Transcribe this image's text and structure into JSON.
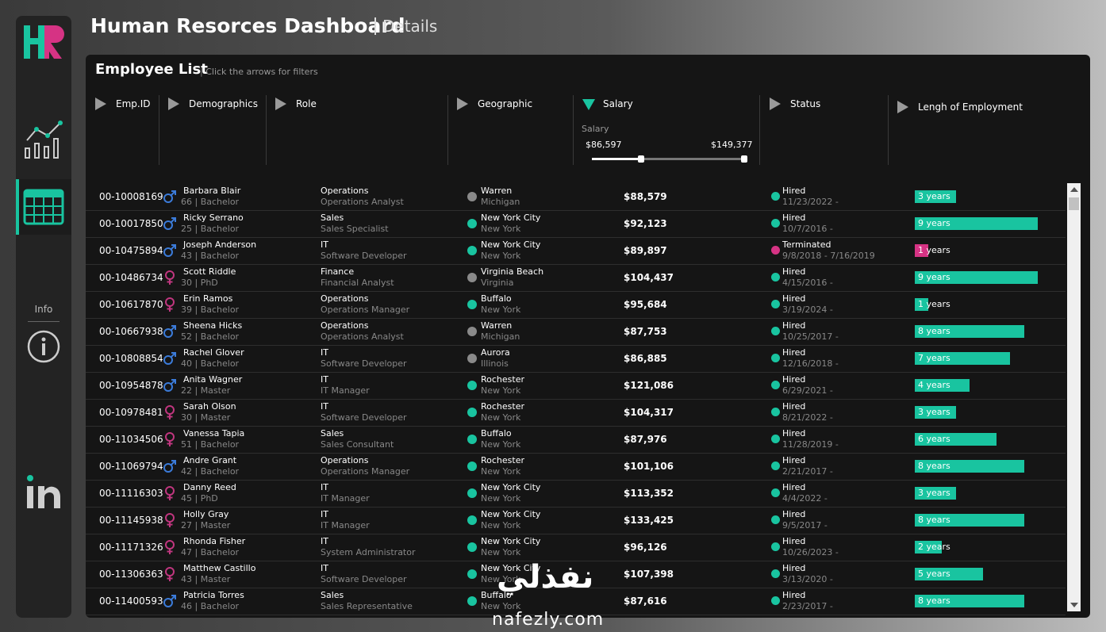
{
  "header": {
    "title": "Human Resorces Dashboard",
    "subtitle": "Details"
  },
  "sidebar": {
    "logo_text": "HR",
    "info_label": "Info",
    "linkedin_text": "in"
  },
  "panel": {
    "title": "Employee List",
    "hint": "Click the arrows for filters"
  },
  "filters": {
    "emp_id": "Emp.ID",
    "demographics": "Demographics",
    "role": "Role",
    "geographic": "Geographic",
    "salary": "Salary",
    "status": "Status",
    "length": "Lengh of Employment",
    "salary_slider": {
      "label": "Salary",
      "min": "$86,597",
      "max": "$149,377"
    }
  },
  "colors": {
    "accent": "#19c4a0",
    "terminated": "#d63384",
    "male": "#3b7bd9",
    "female": "#c0367f",
    "grey_dot": "#8a8a8a"
  },
  "employees": [
    {
      "id": "00-10008169",
      "gender": "male",
      "name": "Barbara Blair",
      "demo": "66  |  Bachelor",
      "dept": "Operations",
      "role": "Operations Analyst",
      "city": "Warren",
      "state": "Michigan",
      "geo": "grey",
      "salary": "$88,579",
      "status": "Hired",
      "date": "11/23/2022 -",
      "years": 3,
      "years_label": "3 years"
    },
    {
      "id": "00-10017850",
      "gender": "male",
      "name": "Ricky Serrano",
      "demo": "25  |  Bachelor",
      "dept": "Sales",
      "role": "Sales Specialist",
      "city": "New York City",
      "state": "New York",
      "geo": "teal",
      "salary": "$92,123",
      "status": "Hired",
      "date": "10/7/2016 -",
      "years": 9,
      "years_label": "9 years"
    },
    {
      "id": "00-10475894",
      "gender": "male",
      "name": "Joseph Anderson",
      "demo": "43  |  Bachelor",
      "dept": "IT",
      "role": "Software Developer",
      "city": "New York City",
      "state": "New York",
      "geo": "teal",
      "salary": "$89,897",
      "status": "Terminated",
      "date": "9/8/2018 - 7/16/2019",
      "years": 1,
      "years_label": "1 years"
    },
    {
      "id": "00-10486734",
      "gender": "female",
      "name": "Scott Riddle",
      "demo": "30  |  PhD",
      "dept": "Finance",
      "role": "Financial Analyst",
      "city": "Virginia Beach",
      "state": "Virginia",
      "geo": "grey",
      "salary": "$104,437",
      "status": "Hired",
      "date": "4/15/2016 -",
      "years": 9,
      "years_label": "9 years"
    },
    {
      "id": "00-10617870",
      "gender": "female",
      "name": "Erin Ramos",
      "demo": "39  |  Bachelor",
      "dept": "Operations",
      "role": "Operations Manager",
      "city": "Buffalo",
      "state": "New York",
      "geo": "teal",
      "salary": "$95,684",
      "status": "Hired",
      "date": "3/19/2024 -",
      "years": 1,
      "years_label": "1 years"
    },
    {
      "id": "00-10667938",
      "gender": "male",
      "name": "Sheena Hicks",
      "demo": "52  |  Bachelor",
      "dept": "Operations",
      "role": "Operations Analyst",
      "city": "Warren",
      "state": "Michigan",
      "geo": "grey",
      "salary": "$87,753",
      "status": "Hired",
      "date": "10/25/2017 -",
      "years": 8,
      "years_label": "8 years"
    },
    {
      "id": "00-10808854",
      "gender": "male",
      "name": "Rachel Glover",
      "demo": "40  |  Bachelor",
      "dept": "IT",
      "role": "Software Developer",
      "city": "Aurora",
      "state": "Illinois",
      "geo": "grey",
      "salary": "$86,885",
      "status": "Hired",
      "date": "12/16/2018 -",
      "years": 7,
      "years_label": "7 years"
    },
    {
      "id": "00-10954878",
      "gender": "male",
      "name": "Anita Wagner",
      "demo": "22  |  Master",
      "dept": "IT",
      "role": "IT Manager",
      "city": "Rochester",
      "state": "New York",
      "geo": "teal",
      "salary": "$121,086",
      "status": "Hired",
      "date": "6/29/2021 -",
      "years": 4,
      "years_label": "4 years"
    },
    {
      "id": "00-10978481",
      "gender": "female",
      "name": "Sarah Olson",
      "demo": "30  |  Master",
      "dept": "IT",
      "role": "Software Developer",
      "city": "Rochester",
      "state": "New York",
      "geo": "teal",
      "salary": "$104,317",
      "status": "Hired",
      "date": "8/21/2022 -",
      "years": 3,
      "years_label": "3 years"
    },
    {
      "id": "00-11034506",
      "gender": "female",
      "name": "Vanessa Tapia",
      "demo": "51  |  Bachelor",
      "dept": "Sales",
      "role": "Sales Consultant",
      "city": "Buffalo",
      "state": "New York",
      "geo": "teal",
      "salary": "$87,976",
      "status": "Hired",
      "date": "11/28/2019 -",
      "years": 6,
      "years_label": "6 years"
    },
    {
      "id": "00-11069794",
      "gender": "male",
      "name": "Andre Grant",
      "demo": "42  |  Bachelor",
      "dept": "Operations",
      "role": "Operations Manager",
      "city": "Rochester",
      "state": "New York",
      "geo": "teal",
      "salary": "$101,106",
      "status": "Hired",
      "date": "2/21/2017 -",
      "years": 8,
      "years_label": "8 years"
    },
    {
      "id": "00-11116303",
      "gender": "female",
      "name": "Danny Reed",
      "demo": "45  |  PhD",
      "dept": "IT",
      "role": "IT Manager",
      "city": "New York City",
      "state": "New York",
      "geo": "teal",
      "salary": "$113,352",
      "status": "Hired",
      "date": "4/4/2022 -",
      "years": 3,
      "years_label": "3 years"
    },
    {
      "id": "00-11145938",
      "gender": "female",
      "name": "Holly Gray",
      "demo": "27  |  Master",
      "dept": "IT",
      "role": "IT Manager",
      "city": "New York City",
      "state": "New York",
      "geo": "teal",
      "salary": "$133,425",
      "status": "Hired",
      "date": "9/5/2017 -",
      "years": 8,
      "years_label": "8 years"
    },
    {
      "id": "00-11171326",
      "gender": "female",
      "name": "Rhonda Fisher",
      "demo": "47  |  Bachelor",
      "dept": "IT",
      "role": "System Administrator",
      "city": "New York City",
      "state": "New York",
      "geo": "teal",
      "salary": "$96,126",
      "status": "Hired",
      "date": "10/26/2023 -",
      "years": 2,
      "years_label": "2 years"
    },
    {
      "id": "00-11306363",
      "gender": "female",
      "name": "Matthew Castillo",
      "demo": "43  |  Master",
      "dept": "IT",
      "role": "Software Developer",
      "city": "New York City",
      "state": "New York",
      "geo": "teal",
      "salary": "$107,398",
      "status": "Hired",
      "date": "3/13/2020 -",
      "years": 5,
      "years_label": "5 years"
    },
    {
      "id": "00-11400593",
      "gender": "male",
      "name": "Patricia Torres",
      "demo": "46  |  Bachelor",
      "dept": "Sales",
      "role": "Sales Representative",
      "city": "Buffalo",
      "state": "New York",
      "geo": "teal",
      "salary": "$87,616",
      "status": "Hired",
      "date": "2/23/2017 -",
      "years": 8,
      "years_label": "8 years"
    }
  ],
  "watermark": {
    "arabic": "نفذلي",
    "latin": "nafezly.com"
  }
}
